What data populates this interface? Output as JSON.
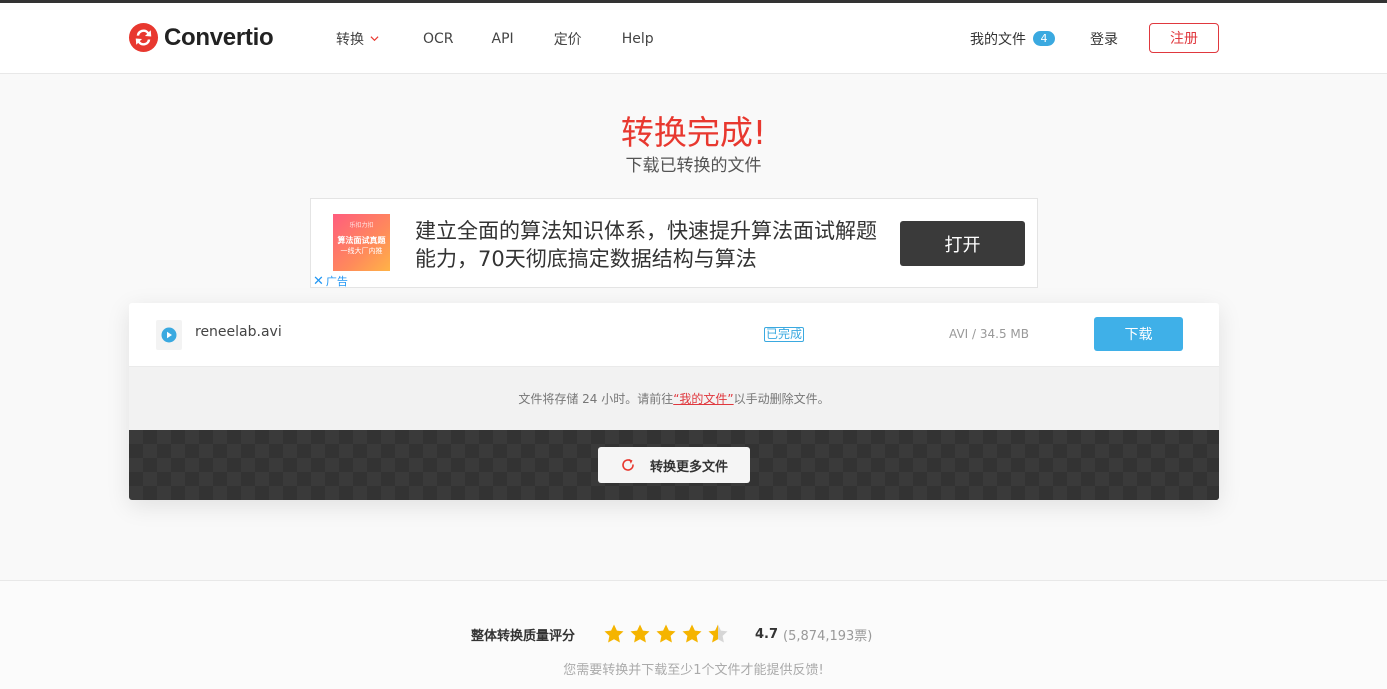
{
  "header": {
    "brand": "Convertio",
    "nav": [
      {
        "label": "转换",
        "has_dropdown": true
      },
      {
        "label": "OCR"
      },
      {
        "label": "API"
      },
      {
        "label": "定价"
      },
      {
        "label": "Help"
      }
    ],
    "my_files_label": "我的文件",
    "my_files_count": "4",
    "login_label": "登录",
    "register_label": "注册"
  },
  "hero": {
    "title": "转换完成!",
    "subtitle": "下载已转换的文件"
  },
  "ad": {
    "thumb_line1": "乐扣力扣",
    "thumb_line2": "算法面试真题",
    "thumb_line3": "一线大厂内推",
    "text": "建立全面的算法知识体系，快速提升算法面试解题能力，70天彻底搞定数据结构与算法",
    "button_label": "打开",
    "close_label": "广告"
  },
  "file": {
    "name": "reneelab.avi",
    "status": "已完成",
    "info": "AVI / 34.5 MB",
    "download_label": "下载"
  },
  "note": {
    "before": "文件将存储 24 小时。请前往",
    "link": "“我的文件”",
    "after": "以手动删除文件。"
  },
  "convert_more_label": "转换更多文件",
  "rating": {
    "label": "整体转换质量评分",
    "value": "4.7",
    "votes": "(5,874,193票)",
    "stars_filled": 4.5,
    "feedback": "您需要转换并下载至少1个文件才能提供反馈!"
  },
  "colors": {
    "brand_red": "#e8382f",
    "accent_blue": "#3fb0e8",
    "star": "#f5b400"
  }
}
